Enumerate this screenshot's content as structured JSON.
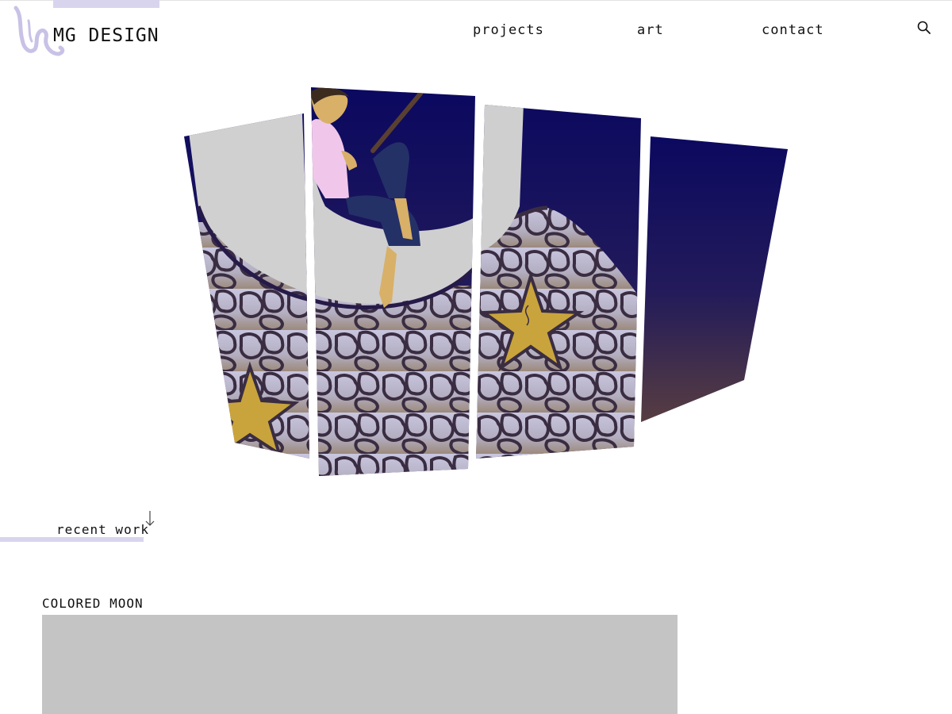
{
  "header": {
    "brand": "MG DESIGN",
    "logo_icon": "mg-monogram-logo",
    "nav": [
      {
        "label": "projects"
      },
      {
        "label": "art"
      },
      {
        "label": "contact"
      }
    ],
    "search_icon": "magnifier-icon"
  },
  "hero": {
    "artwork_icon": "boy-fishing-on-crescent-moon-artwork"
  },
  "recent": {
    "label": "recent work",
    "arrow_icon": "arrow-down-icon"
  },
  "project": {
    "title": "COLORED MOON"
  },
  "colors": {
    "accent": "#d9d4ee",
    "night_sky": "#0a0860",
    "dusk": "#5a3f40",
    "moon": "#cfcfcf",
    "star": "#c9a43c",
    "thumb": "#c4c4c4"
  }
}
